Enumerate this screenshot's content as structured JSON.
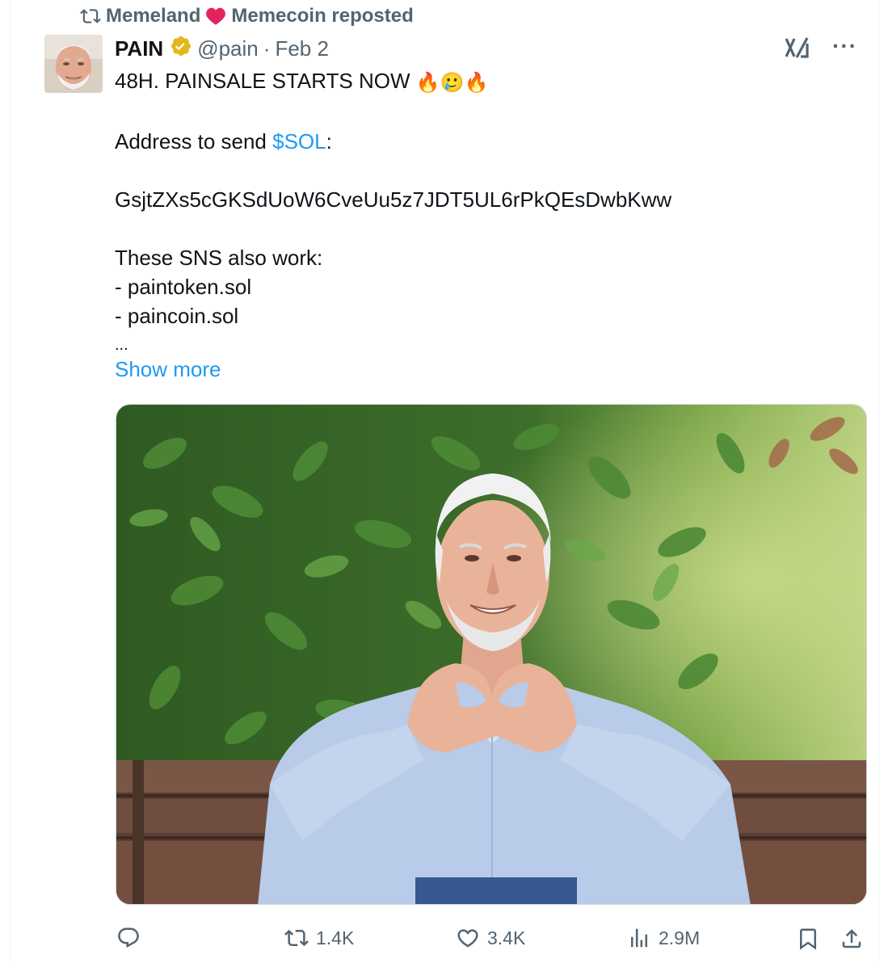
{
  "repost": {
    "icon": "repost-icon",
    "user1": "Memeland",
    "user2_text": "Memecoin reposted"
  },
  "author": {
    "name": "PAIN",
    "handle": "@pain",
    "separator": "·",
    "date": "Feb 2",
    "verified_color": "#e2b719"
  },
  "tweet": {
    "line1": "48H. PAINSALE STARTS NOW",
    "line1_emojis": "🔥🥲🔥",
    "address_prefix": "Address to send ",
    "cashtag": "$SOL",
    "address_suffix": ":",
    "address": "GsjtZXs5cGKSdUoW6CveUu5z7JDT5UL6rPkQEsDwbKww",
    "sns_header": "These SNS also work:",
    "sns1": "- paintoken.sol",
    "sns2": "- paincoin.sol",
    "ellipsis": "...",
    "show_more": "Show more"
  },
  "top_right": {
    "grok_label": "x/",
    "more_label": "···"
  },
  "actions": {
    "reply_count": "",
    "repost_count": "1.4K",
    "like_count": "3.4K",
    "views_count": "2.9M"
  },
  "colors": {
    "link": "#1d9bf0",
    "secondary": "#536471",
    "heart": "#e0245e"
  }
}
